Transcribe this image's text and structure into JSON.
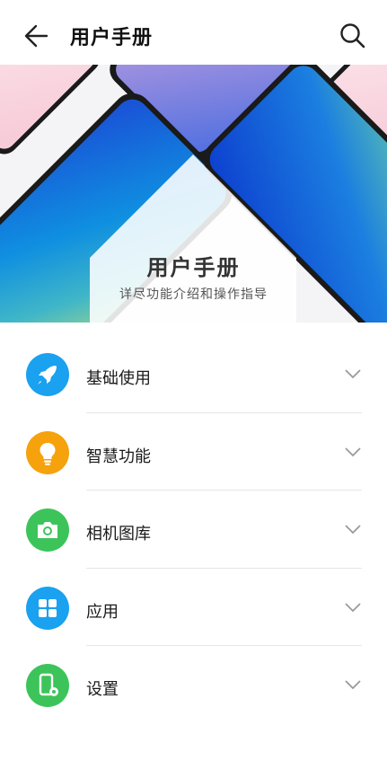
{
  "header": {
    "title": "用户手册"
  },
  "banner": {
    "title": "用户手册",
    "subtitle": "详尽功能介绍和操作指导"
  },
  "menu": [
    {
      "label": "基础使用",
      "icon": "rocket-icon",
      "color": "#1aa1f0"
    },
    {
      "label": "智慧功能",
      "icon": "lightbulb-icon",
      "color": "#f5a20d"
    },
    {
      "label": "相机图库",
      "icon": "camera-icon",
      "color": "#3cc45a"
    },
    {
      "label": "应用",
      "icon": "apps-grid-icon",
      "color": "#1aa1f0"
    },
    {
      "label": "设置",
      "icon": "phone-settings-icon",
      "color": "#3cc45a"
    }
  ]
}
